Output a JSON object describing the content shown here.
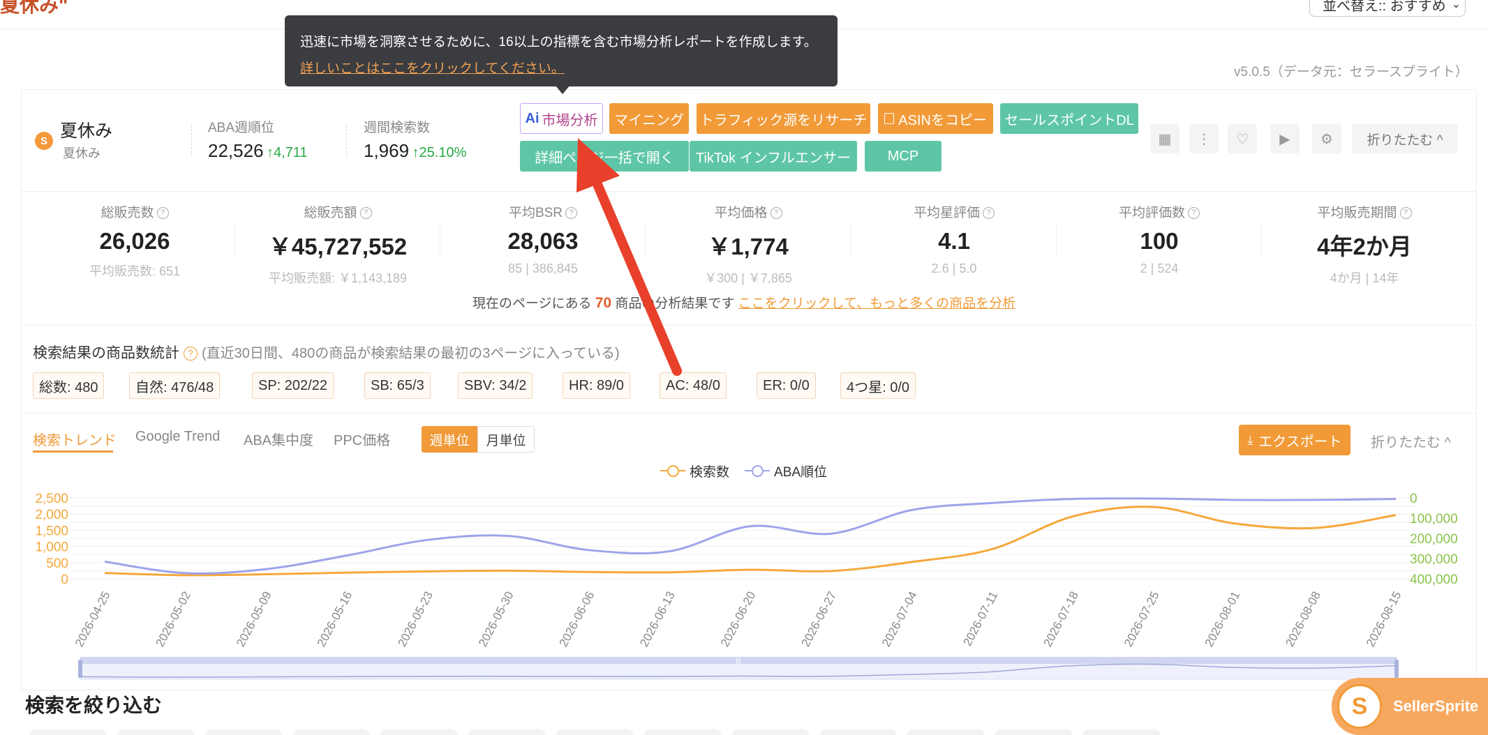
{
  "header": {
    "left_title": "夏休み\"",
    "sort_label": "並べ替え:: おすすめ",
    "version": "v5.0.5（データ元：セラースプライト）"
  },
  "tooltip": {
    "text": "迅速に市場を洞察させるために、16以上の指標を含む市場分析レポートを作成します。",
    "link": "詳しいことはここをクリックしてください。"
  },
  "keyword": {
    "logo_letter": "S",
    "title": "夏休み",
    "subtitle": "夏休み",
    "aba_rank_label": "ABA週順位",
    "aba_rank_value": "22,526",
    "aba_rank_delta": "↑4,711",
    "weekly_search_label": "週間検索数",
    "weekly_search_value": "1,969",
    "weekly_search_delta": "↑25.10%"
  },
  "actions": {
    "ai_market": "市場分析",
    "ai_prefix": "Ai",
    "mining": "マイニング",
    "traffic": "トラフィック源をリサーチ",
    "copy_asin": "ASINをコピー",
    "sales_points": "セールスポイントDL",
    "open_details": "詳細ページ一括で開く",
    "tiktok": "TikTok インフルエンサー",
    "mcp": "MCP",
    "fold": "折りたたむ ^"
  },
  "metrics": [
    {
      "label": "総販売数",
      "value": "26,026",
      "sub": "平均販売数: 651"
    },
    {
      "label": "総販売額",
      "value": "￥45,727,552",
      "sub": "平均販売額: ￥1,143,189"
    },
    {
      "label": "平均BSR",
      "value": "28,063",
      "sub": "85 | 386,845"
    },
    {
      "label": "平均価格",
      "value": "￥1,774",
      "sub": "￥300 | ￥7,865"
    },
    {
      "label": "平均星評価",
      "value": "4.1",
      "sub": "2.6 | 5.0"
    },
    {
      "label": "平均評価数",
      "value": "100",
      "sub": "2 | 524"
    },
    {
      "label": "平均販売期間",
      "value": "4年2か月",
      "sub": "4か月 | 14年"
    }
  ],
  "page_note": {
    "prefix": "現在のページにある",
    "count": "70",
    "suffix": "商品の分析結果です",
    "link": "ここをクリックして、もっと多くの商品を分析"
  },
  "counts": {
    "title": "検索結果の商品数統計",
    "note": "(直近30日間、480の商品が検索結果の最初の3ページに入っている)",
    "chips": [
      "総数: 480",
      "自然: 476/48",
      "SP: 202/22",
      "SB: 65/3",
      "SBV: 34/2",
      "HR: 89/0",
      "AC: 48/0",
      "ER: 0/0",
      "4つ星: 0/0"
    ]
  },
  "trend": {
    "tabs": [
      "検索トレンド",
      "Google Trend",
      "ABA集中度",
      "PPC価格"
    ],
    "seg_week": "週単位",
    "seg_month": "月単位",
    "export": "エクスポート",
    "fold": "折りたたむ ^"
  },
  "chart_data": {
    "type": "line",
    "x": [
      "2026-04-25",
      "2026-05-02",
      "2026-05-09",
      "2026-05-16",
      "2026-05-23",
      "2026-05-30",
      "2026-06-06",
      "2026-06-13",
      "2026-06-20",
      "2026-06-27",
      "2026-07-04",
      "2026-07-11",
      "2026-07-18",
      "2026-07-25",
      "2026-08-01",
      "2026-08-08",
      "2026-08-15"
    ],
    "series": [
      {
        "name": "検索数",
        "axis": "left",
        "color": "#f5a83b",
        "values": [
          180,
          110,
          140,
          190,
          230,
          250,
          210,
          200,
          280,
          240,
          520,
          920,
          1930,
          2220,
          1710,
          1570,
          1969
        ]
      },
      {
        "name": "ABA順位",
        "axis": "right",
        "color": "#9ea3ea",
        "values": [
          315000,
          372000,
          352000,
          285000,
          208000,
          188000,
          258000,
          264000,
          140000,
          177000,
          60000,
          25000,
          5000,
          3000,
          10000,
          10000,
          5000
        ]
      }
    ],
    "left_axis": {
      "min": 0,
      "max": 2500,
      "ticks": [
        "0",
        "500",
        "1,000",
        "1,500",
        "2,000",
        "2,500"
      ],
      "color": "#f5a83b"
    },
    "right_axis": {
      "min": 0,
      "max": 400000,
      "reversed": true,
      "ticks": [
        "0",
        "100,000",
        "200,000",
        "300,000",
        "400,000"
      ],
      "color": "#8bc34a"
    },
    "legend_position": "top-center",
    "grid": true
  },
  "filter": {
    "title": "検索を絞り込む"
  },
  "brand": {
    "name": "SellerSprite",
    "logo_letter": "S"
  },
  "colors": {
    "accent": "#f19a37",
    "green_button": "#5ec6a6",
    "tooltip_bg": "#3a3c40",
    "arrow": "#e8402a"
  }
}
